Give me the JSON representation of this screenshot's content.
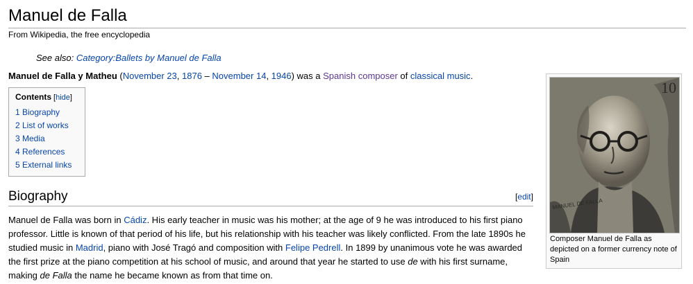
{
  "page": {
    "title": "Manuel de Falla",
    "tagline": "From Wikipedia, the free encyclopedia"
  },
  "seealso": {
    "prefix": "See also: ",
    "link": "Category:Ballets by Manuel de Falla"
  },
  "lead": {
    "name": "Manuel de Falla y Matheu",
    "p_open": " (",
    "birth_date": "November 23",
    "comma1": ", ",
    "birth_year": "1876",
    "dash": " – ",
    "death_date": "November 14",
    "comma2": ", ",
    "death_year": "1946",
    "p_close": ") was a ",
    "spanish": "Spanish",
    "space1": " ",
    "composer": "composer",
    "of": " of ",
    "classical": "classical music",
    "end": "."
  },
  "toc": {
    "title": "Contents",
    "hide_open": " [",
    "hide": "hide",
    "hide_close": "]",
    "items": [
      {
        "label": "1 Biography"
      },
      {
        "label": "2 List of works"
      },
      {
        "label": "3 Media"
      },
      {
        "label": "4 References"
      },
      {
        "label": "5 External links"
      }
    ]
  },
  "biography": {
    "heading": "Biography",
    "edit_open": "[",
    "edit": "edit",
    "edit_close": "]",
    "t1": "Manuel de Falla was born in ",
    "cadiz": "Cádiz",
    "t2": ". His early teacher in music was his mother; at the age of 9 he was introduced to his first piano professor. Little is known of that period of his life, but his relationship with his teacher was likely conflicted. From the late 1890s he studied music in ",
    "madrid": "Madrid",
    "t3": ", piano with José Tragó and composition with ",
    "pedrell": "Felipe Pedrell",
    "t4": ". In 1899 by unanimous vote he was awarded the first prize at the piano competition at his school of music, and around that year he started to use ",
    "de": "de",
    "t5": " with his first surname, making ",
    "defalla": "de Falla",
    "t6": " the name he became known as from that time on."
  },
  "infobox": {
    "caption": "Composer Manuel de Falla as depicted on a former currency note of Spain",
    "note_text": "MANUEL DE FALLA",
    "note_value": "10"
  }
}
